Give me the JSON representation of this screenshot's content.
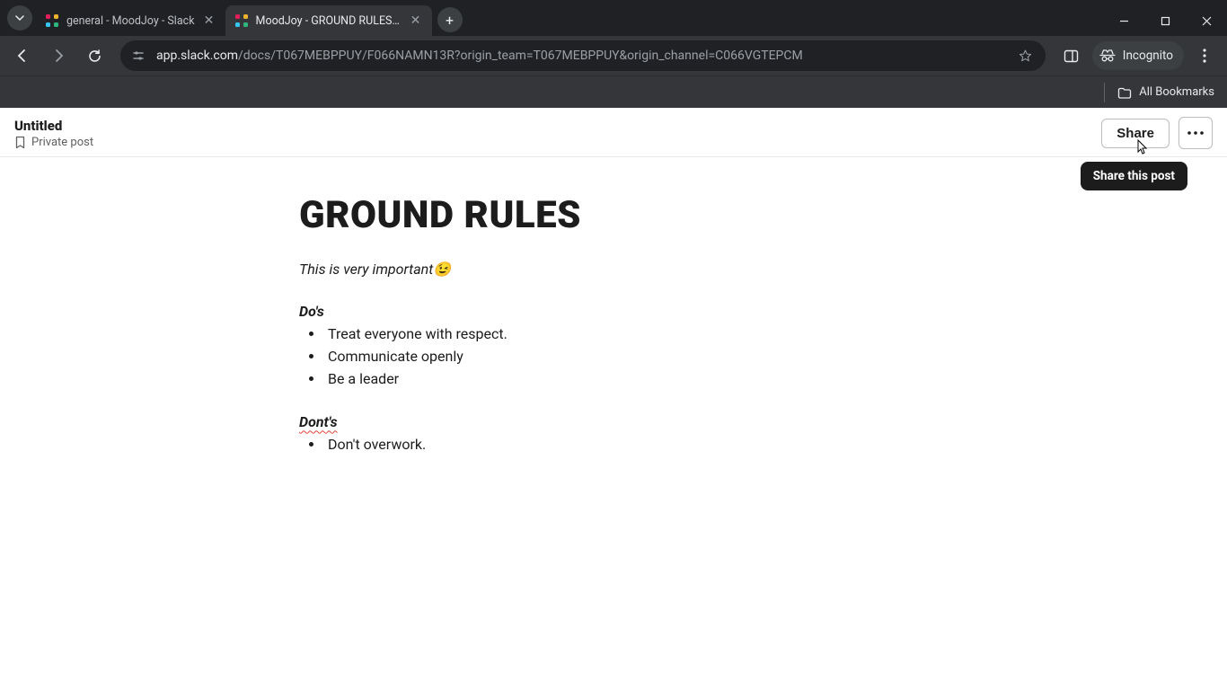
{
  "browser": {
    "tabs": [
      {
        "title": "general - MoodJoy - Slack",
        "active": false
      },
      {
        "title": "MoodJoy - GROUND RULES - S",
        "active": true
      }
    ],
    "url_host": "app.slack.com",
    "url_path": "/docs/T067MEBPPUY/F066NAMN13R?origin_team=T067MEBPPUY&origin_channel=C066VGTEPCM",
    "incognito_label": "Incognito",
    "bookmarks_label": "All Bookmarks"
  },
  "doc_header": {
    "title": "Untitled",
    "privacy": "Private post",
    "share_label": "Share",
    "tooltip": "Share this post"
  },
  "document": {
    "heading": "GROUND RULES",
    "intro_text": "This is very important",
    "intro_emoji": "😉",
    "dos_heading": "Do's",
    "dos_items": [
      "Treat everyone with respect.",
      "Communicate openly",
      "Be a leader"
    ],
    "donts_heading": "Dont's",
    "donts_items": [
      "Don't overwork."
    ]
  }
}
